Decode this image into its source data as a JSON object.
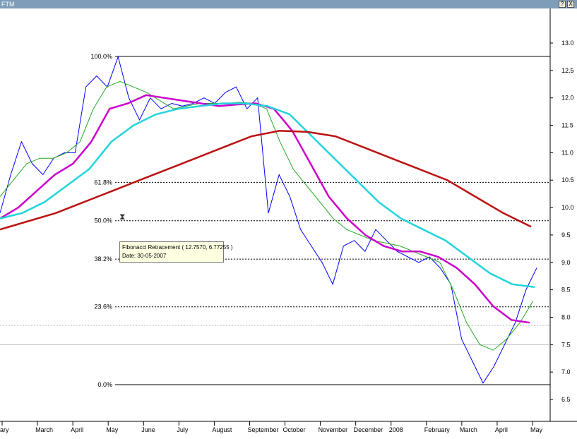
{
  "window": {
    "title": "FTM",
    "help_label": "?",
    "close_label": "X"
  },
  "chart_data": {
    "type": "line",
    "title": "",
    "xlabel": "",
    "ylabel": "",
    "ylim": [
      6.2,
      13.3
    ],
    "y_ticks": [
      "13.0",
      "12.5",
      "12.0",
      "11.5",
      "11.0",
      "10.5",
      "10.0",
      "9.5",
      "9.0",
      "8.5",
      "8.0",
      "7.5",
      "7.0",
      "6.5"
    ],
    "x_ticks": [
      "ary",
      "March",
      "April",
      "May",
      "June",
      "July",
      "August",
      "September",
      "October",
      "November",
      "December",
      "2008",
      "February",
      "March",
      "April",
      "May"
    ],
    "fibonacci": {
      "levels": [
        {
          "label": "100.0%",
          "price": 12.757
        },
        {
          "label": "61.8%",
          "price": 10.46
        },
        {
          "label": "50.0%",
          "price": 9.76
        },
        {
          "label": "38.2%",
          "price": 9.06
        },
        {
          "label": "23.6%",
          "price": 8.19
        },
        {
          "label": "0.0%",
          "price": 6.77
        }
      ],
      "tooltip_line1": "Fibonacci Retracement ( 12.7570, 6.77255 )",
      "tooltip_line2": "Date: 30-05-2007"
    },
    "series": [
      {
        "color": "#0000ff",
        "values": [
          9.9,
          10.6,
          11.2,
          10.8,
          10.6,
          10.9,
          11.0,
          11.0,
          12.2,
          12.4,
          12.2,
          12.75,
          12.0,
          11.6,
          12.0,
          11.8,
          11.9,
          11.85,
          11.9,
          12.0,
          11.9,
          12.1,
          12.2,
          11.8,
          12.0,
          9.9,
          10.6,
          10.2,
          9.6,
          9.3,
          9.0,
          8.6,
          9.3,
          9.4,
          9.2,
          9.6,
          9.4,
          9.2,
          9.1,
          9.0,
          9.1,
          8.9,
          8.6,
          7.6,
          7.2,
          6.8,
          7.1,
          7.5,
          7.9,
          8.5,
          8.9
        ]
      },
      {
        "color": "#22aa22",
        "values": [
          10.2,
          10.5,
          10.8,
          10.9,
          10.9,
          11.0,
          11.2,
          11.8,
          12.2,
          12.3,
          12.2,
          12.1,
          11.95,
          11.8,
          11.85,
          11.9,
          11.9,
          11.9,
          11.92,
          11.9,
          11.8,
          11.2,
          10.7,
          10.4,
          10.1,
          9.8,
          9.6,
          9.5,
          9.4,
          9.35,
          9.3,
          9.2,
          9.1,
          9.0,
          8.5,
          7.9,
          7.5,
          7.4,
          7.6,
          7.9,
          8.3
        ]
      },
      {
        "color": "#cc00cc",
        "values": [
          9.8,
          10.0,
          10.3,
          10.6,
          10.8,
          11.2,
          11.8,
          11.9,
          12.05,
          12.0,
          11.95,
          11.9,
          11.85,
          11.88,
          11.9,
          11.8,
          11.4,
          10.8,
          10.2,
          9.8,
          9.5,
          9.3,
          9.2,
          9.2,
          9.1,
          8.9,
          8.6,
          8.2,
          7.95,
          7.9
        ]
      },
      {
        "color": "#22d4dc",
        "values": [
          9.8,
          9.9,
          10.1,
          10.4,
          10.7,
          11.2,
          11.5,
          11.7,
          11.8,
          11.85,
          11.9,
          11.9,
          11.85,
          11.7,
          11.3,
          10.9,
          10.5,
          10.1,
          9.8,
          9.6,
          9.4,
          9.1,
          8.8,
          8.6,
          8.55
        ]
      },
      {
        "color": "#bb1111",
        "values": [
          9.6,
          9.75,
          9.9,
          10.1,
          10.3,
          10.5,
          10.7,
          10.9,
          11.1,
          11.3,
          11.4,
          11.38,
          11.3,
          11.1,
          10.9,
          10.7,
          10.5,
          10.2,
          9.9,
          9.65
        ]
      }
    ]
  }
}
